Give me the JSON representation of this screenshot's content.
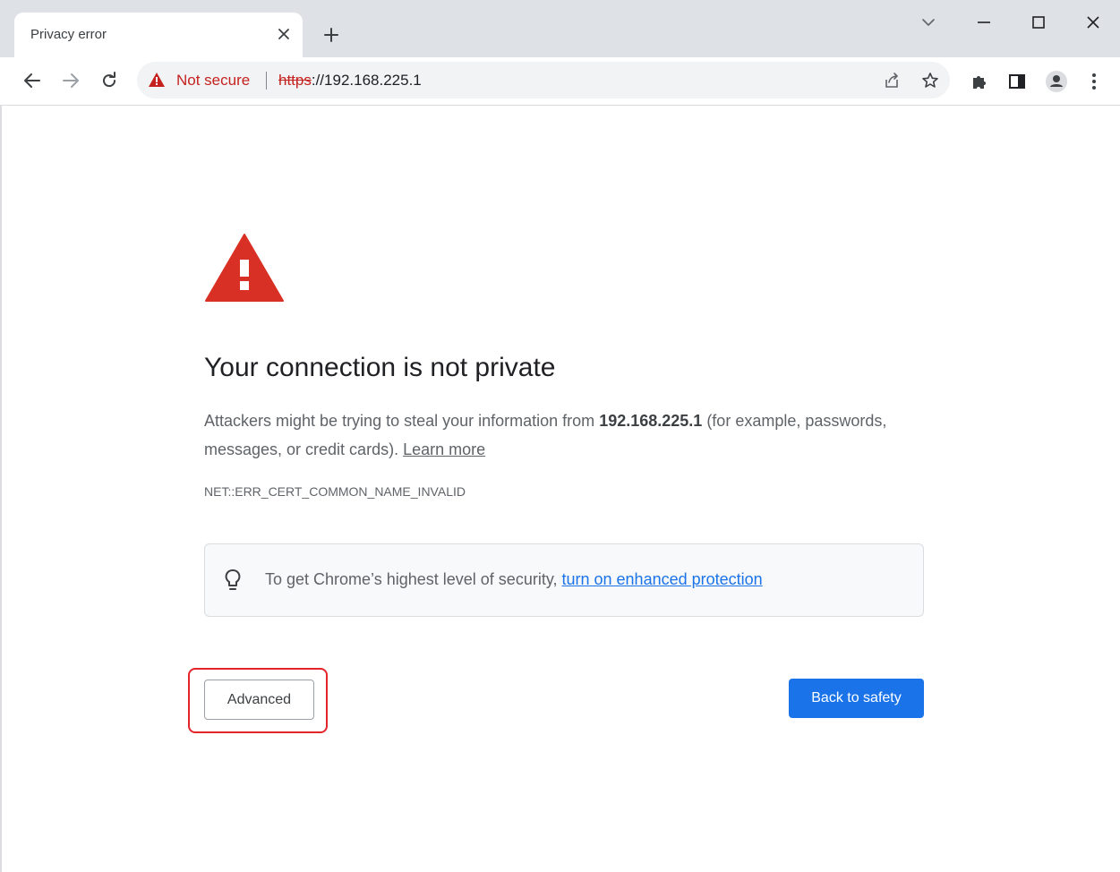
{
  "tab": {
    "title": "Privacy error"
  },
  "omnibox": {
    "security_label": "Not secure",
    "url_scheme": "https",
    "url_rest": "://192.168.225.1"
  },
  "icons": {
    "tab_close": "close-icon",
    "new_tab": "plus-icon",
    "tab_search": "chevron-down-icon",
    "minimize": "minimize-icon",
    "maximize": "maximize-icon",
    "close": "close-icon",
    "back": "back-arrow-icon",
    "forward": "forward-arrow-icon",
    "reload": "reload-icon",
    "share": "share-icon",
    "bookmark": "star-icon",
    "extensions": "puzzle-icon",
    "side_panel": "side-panel-icon",
    "profile": "profile-icon",
    "menu": "kebab-menu-icon",
    "warning": "warning-triangle-icon",
    "bulb": "lightbulb-icon"
  },
  "page": {
    "headline": "Your connection is not private",
    "explain_before": "Attackers might be trying to steal your information from ",
    "host": "192.168.225.1",
    "explain_after": " (for example, passwords, messages, or credit cards). ",
    "learn_more": "Learn more",
    "error_code": "NET::ERR_CERT_COMMON_NAME_INVALID",
    "enhanced_text": "To get Chrome’s highest level of security, ",
    "enhanced_link": "turn on enhanced protection",
    "advanced_button": "Advanced",
    "back_button": "Back to safety"
  },
  "colors": {
    "warning_red": "#d93025",
    "link_blue": "#1a73e8",
    "highlight_red": "#e3242b",
    "tabstrip_bg": "#dee1e6"
  }
}
